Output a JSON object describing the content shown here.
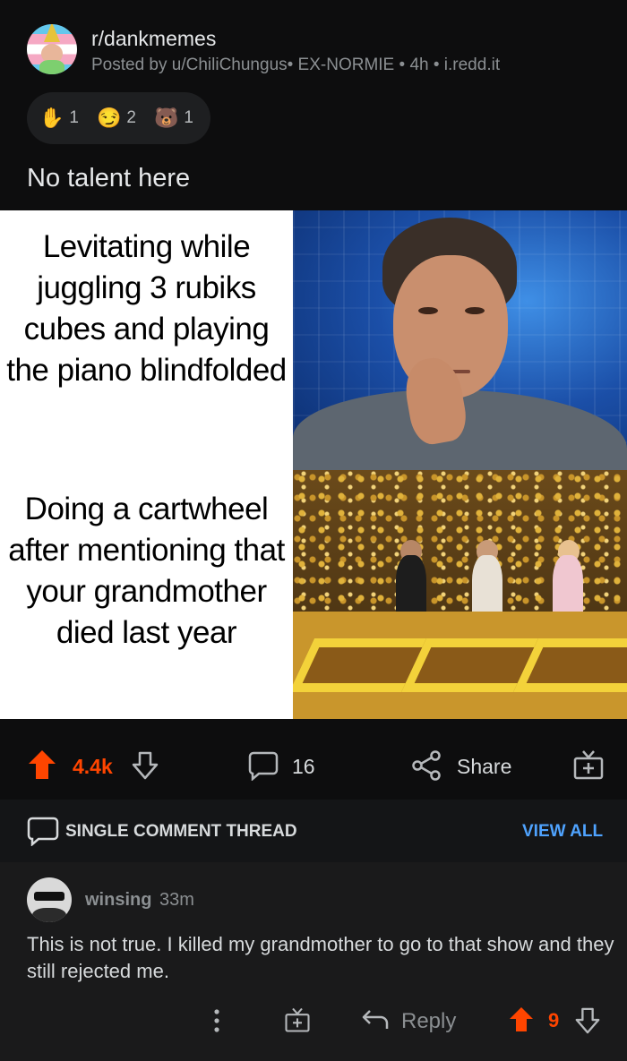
{
  "post": {
    "subreddit": "r/dankmemes",
    "meta": "Posted by u/ChiliChungus• EX-NORMIE • 4h • i.redd.it",
    "awards": [
      {
        "icon": "wholesome-seal-award-icon",
        "glyph": "✋",
        "count": "1"
      },
      {
        "icon": "silver-face-award-icon",
        "glyph": "😏",
        "count": "2"
      },
      {
        "icon": "bear-award-icon",
        "glyph": "🐻",
        "count": "1"
      }
    ],
    "title": "No talent here"
  },
  "meme": {
    "top_text": "Levitating while juggling 3 rubiks cubes and playing the piano blindfolded",
    "bottom_text": "Doing a cartwheel after mentioning that your grandmother died last year"
  },
  "actions": {
    "score": "4.4k",
    "comments": "16",
    "share_label": "Share"
  },
  "thread": {
    "label": "SINGLE COMMENT THREAD",
    "view_all": "VIEW ALL"
  },
  "comment": {
    "username": "winsing",
    "age": "33m",
    "body": "This is not true. I killed my grandmother to go to that show and they still rejected me.",
    "reply_label": "Reply",
    "score": "9"
  },
  "colors": {
    "upvote": "#ff4500",
    "link": "#4fa3ff",
    "background": "#0b0b0c"
  }
}
